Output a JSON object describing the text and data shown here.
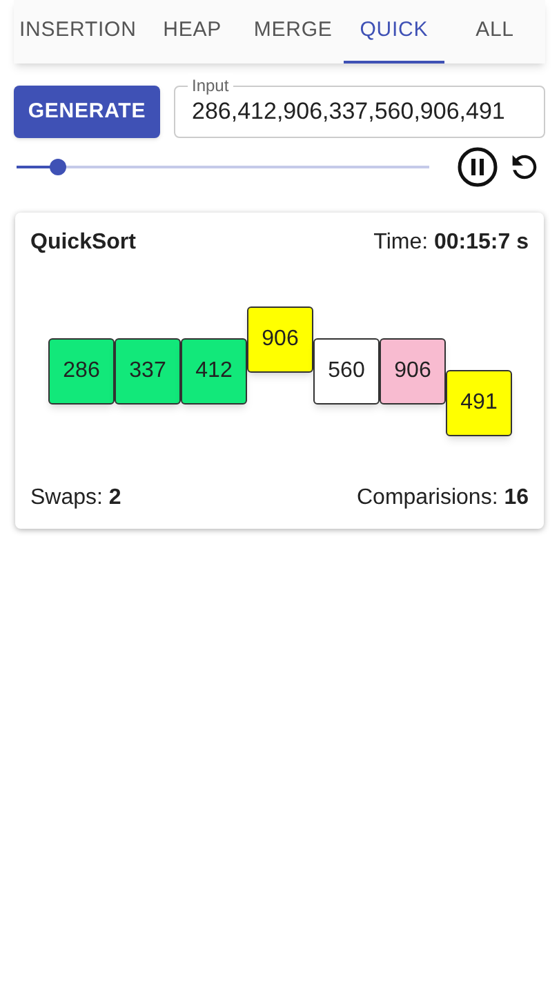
{
  "tabs": [
    {
      "label": "INSERTION",
      "selected": false
    },
    {
      "label": "HEAP",
      "selected": false
    },
    {
      "label": "MERGE",
      "selected": false
    },
    {
      "label": "QUICK",
      "selected": true
    },
    {
      "label": "ALL",
      "selected": false
    }
  ],
  "generate_button": "GENERATE",
  "input": {
    "label": "Input",
    "value": "286,412,906,337,560,906,491"
  },
  "speed_slider": {
    "level": 0.1
  },
  "card": {
    "title": "QuickSort",
    "time": "Time: **00:15:7 s**",
    "bars": [
      {
        "value": "286",
        "color": "#12e87a",
        "kind": "level"
      },
      {
        "value": "337",
        "color": "#12e87a",
        "kind": "level"
      },
      {
        "value": "412",
        "color": "#12e87a",
        "kind": "level"
      },
      {
        "value": "906",
        "color": "#ffff00",
        "kind": "raised"
      },
      {
        "value": "560",
        "color": "#ffffff",
        "kind": "level"
      },
      {
        "value": "906",
        "color": "#f8bbd0",
        "kind": "level"
      },
      {
        "value": "491",
        "color": "#ffff00",
        "kind": "lowered"
      }
    ],
    "swaps": "Swaps: **2**",
    "comparisons": "Comparisions: **16**"
  }
}
